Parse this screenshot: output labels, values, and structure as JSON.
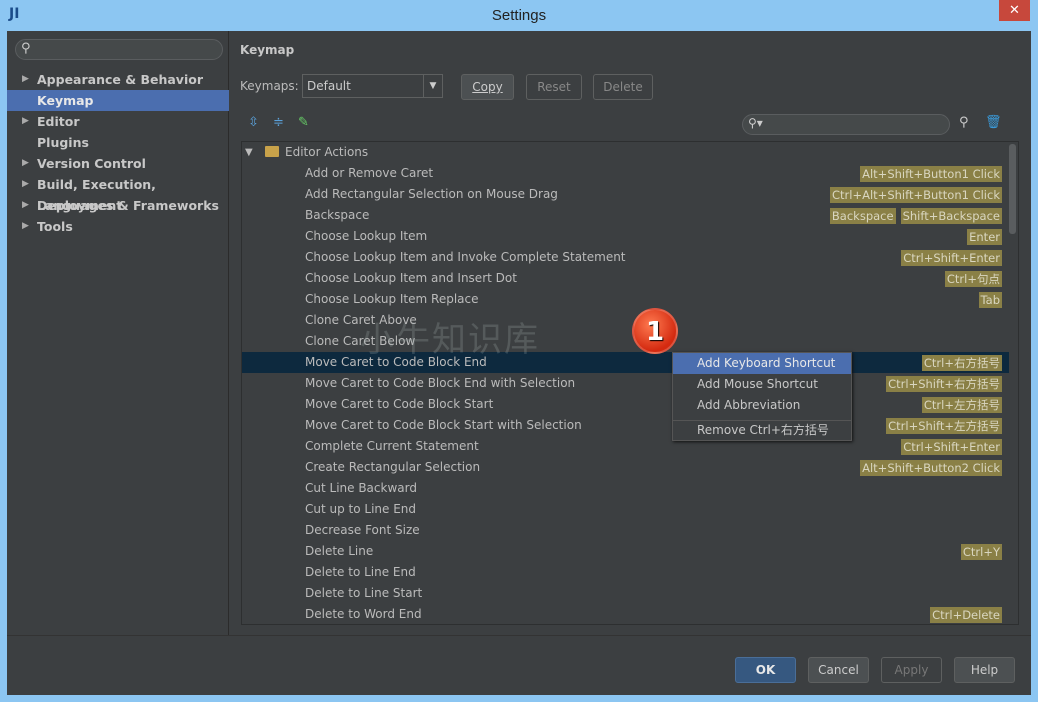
{
  "window": {
    "title": "Settings",
    "app_icon": "intellij-icon",
    "close": "✕"
  },
  "sidebar": {
    "search_placeholder": "",
    "items": [
      {
        "label": "Appearance & Behavior",
        "expandable": true
      },
      {
        "label": "Keymap",
        "expandable": false,
        "selected": true
      },
      {
        "label": "Editor",
        "expandable": true
      },
      {
        "label": "Plugins",
        "expandable": false
      },
      {
        "label": "Version Control",
        "expandable": true
      },
      {
        "label": "Build, Execution, Deployment",
        "expandable": true
      },
      {
        "label": "Languages & Frameworks",
        "expandable": true
      },
      {
        "label": "Tools",
        "expandable": true
      }
    ]
  },
  "main": {
    "title": "Keymap",
    "keymaps_label": "Keymaps:",
    "keymap_value": "Default",
    "copy": "Copy",
    "reset": "Reset",
    "delete": "Delete"
  },
  "tree": {
    "group": "Editor Actions",
    "rows": [
      {
        "label": "Add or Remove Caret",
        "shortcuts": [
          "Alt+Shift+Button1 Click"
        ]
      },
      {
        "label": "Add Rectangular Selection on Mouse Drag",
        "shortcuts": [
          "Ctrl+Alt+Shift+Button1 Click"
        ]
      },
      {
        "label": "Backspace",
        "shortcuts": [
          "Backspace",
          "Shift+Backspace"
        ]
      },
      {
        "label": "Choose Lookup Item",
        "shortcuts": [
          "Enter"
        ]
      },
      {
        "label": "Choose Lookup Item and Invoke Complete Statement",
        "shortcuts": [
          "Ctrl+Shift+Enter"
        ]
      },
      {
        "label": "Choose Lookup Item and Insert Dot",
        "shortcuts": [
          "Ctrl+句点"
        ]
      },
      {
        "label": "Choose Lookup Item Replace",
        "shortcuts": [
          "Tab"
        ]
      },
      {
        "label": "Clone Caret Above",
        "shortcuts": []
      },
      {
        "label": "Clone Caret Below",
        "shortcuts": []
      },
      {
        "label": "Move Caret to Code Block End",
        "shortcuts": [
          "Ctrl+右方括号"
        ],
        "selected": true
      },
      {
        "label": "Move Caret to Code Block End with Selection",
        "shortcuts": [
          "Ctrl+Shift+右方括号"
        ]
      },
      {
        "label": "Move Caret to Code Block Start",
        "shortcuts": [
          "Ctrl+左方括号"
        ]
      },
      {
        "label": "Move Caret to Code Block Start with Selection",
        "shortcuts": [
          "Ctrl+Shift+左方括号"
        ]
      },
      {
        "label": "Complete Current Statement",
        "shortcuts": [
          "Ctrl+Shift+Enter"
        ]
      },
      {
        "label": "Create Rectangular Selection",
        "shortcuts": [
          "Alt+Shift+Button2 Click"
        ]
      },
      {
        "label": "Cut Line Backward",
        "shortcuts": []
      },
      {
        "label": "Cut up to Line End",
        "shortcuts": []
      },
      {
        "label": "Decrease Font Size",
        "shortcuts": []
      },
      {
        "label": "Delete Line",
        "shortcuts": [
          "Ctrl+Y"
        ]
      },
      {
        "label": "Delete to Line End",
        "shortcuts": []
      },
      {
        "label": "Delete to Line Start",
        "shortcuts": []
      },
      {
        "label": "Delete to Word End",
        "shortcuts": [
          "Ctrl+Delete"
        ]
      }
    ]
  },
  "context_menu": {
    "items": [
      "Add Keyboard Shortcut",
      "Add Mouse Shortcut",
      "Add Abbreviation"
    ],
    "remove": "Remove Ctrl+右方括号"
  },
  "step_badge": "1",
  "watermark": "小牛知识库",
  "footer": {
    "ok": "OK",
    "cancel": "Cancel",
    "apply": "Apply",
    "help": "Help"
  },
  "colors": {
    "accent": "#4b6eaf",
    "selected_row": "#0d293e",
    "shortcut_badge": "#8a8046",
    "titlebar": "#8cc6f2"
  }
}
